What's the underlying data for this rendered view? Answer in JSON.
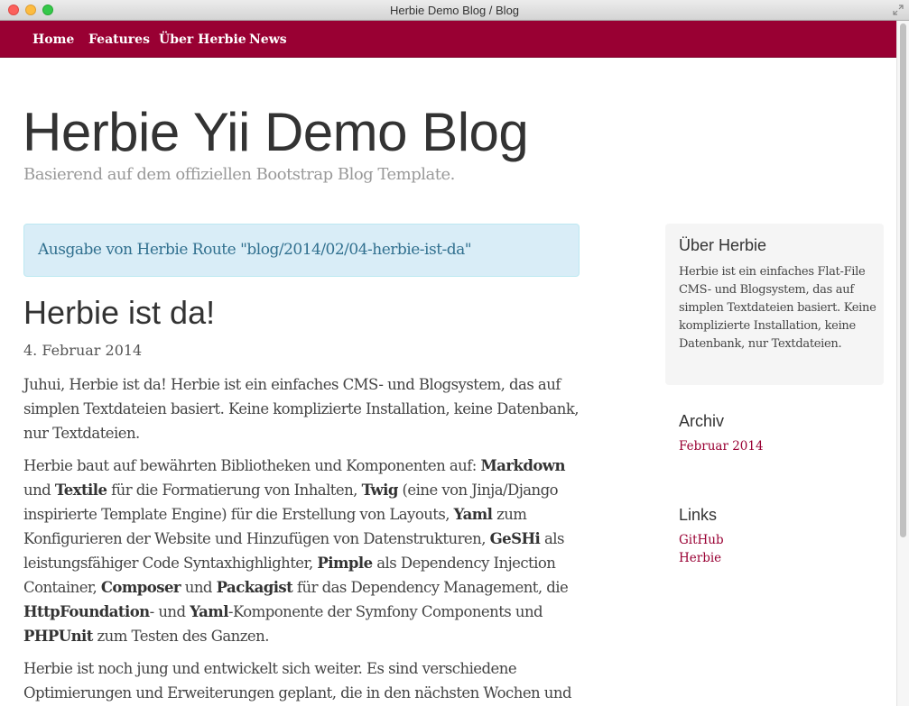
{
  "window": {
    "title": "Herbie Demo Blog / Blog"
  },
  "nav": {
    "items": [
      {
        "label": "Home"
      },
      {
        "label": "Features"
      },
      {
        "label": "Über Herbie"
      },
      {
        "label": "News"
      }
    ]
  },
  "header": {
    "title": "Herbie Yii Demo Blog",
    "description": "Basierend auf dem offiziellen Bootstrap Blog Template."
  },
  "alert": {
    "text": "Ausgabe von Herbie Route \"blog/2014/02/04-herbie-ist-da\""
  },
  "post": {
    "title": "Herbie ist da!",
    "date": "4. Februar 2014",
    "p1": "Juhui, Herbie ist da! Herbie ist ein einfaches CMS- und Blogsystem, das auf simplen Textdateien basiert. Keine komplizierte Installation, keine Datenbank, nur Textdateien.",
    "p2": {
      "t1": "Herbie baut auf bewährten Bibliotheken und Komponenten auf: ",
      "b1": "Markdown",
      "t2": " und ",
      "b2": "Textile",
      "t3": " für die Formatierung von Inhalten, ",
      "b3": "Twig",
      "t4": " (eine von Jinja/Django inspirierte Template Engine) für die Erstellung von Layouts, ",
      "b4": "Yaml",
      "t5": " zum Konfigurieren der Website und Hinzufügen von Datenstrukturen, ",
      "b5": "GeSHi",
      "t6": " als leistungsfähiger Code Syntaxhighlighter, ",
      "b6": "Pimple",
      "t7": " als Dependency Injection Container, ",
      "b7": "Composer",
      "t8": " und ",
      "b8": "Packagist",
      "t9": " für das Dependency Management, die ",
      "b9": "HttpFoundation",
      "t10": "- und ",
      "b10": "Yaml",
      "t11": "-Komponente der Symfony Components und ",
      "b11": "PHPUnit",
      "t12": " zum Testen des Ganzen."
    },
    "p3": "Herbie ist noch jung und entwickelt sich weiter. Es sind verschiedene Optimierungen und Erweiterungen geplant, die in den nächsten Wochen und"
  },
  "sidebar": {
    "about": {
      "title": "Über Herbie",
      "text": "Herbie ist ein einfaches Flat-File CMS- und Blogsystem, das auf simplen Textdateien basiert. Keine komplizierte Installation, keine Datenbank, nur Textdateien."
    },
    "archive": {
      "title": "Archiv",
      "links": [
        {
          "label": "Februar 2014"
        }
      ]
    },
    "links": {
      "title": "Links",
      "links": [
        {
          "label": "GitHub"
        },
        {
          "label": "Herbie"
        }
      ]
    }
  },
  "colors": {
    "brand": "#990033",
    "alert_bg": "#d9edf7",
    "alert_text": "#31708f"
  }
}
